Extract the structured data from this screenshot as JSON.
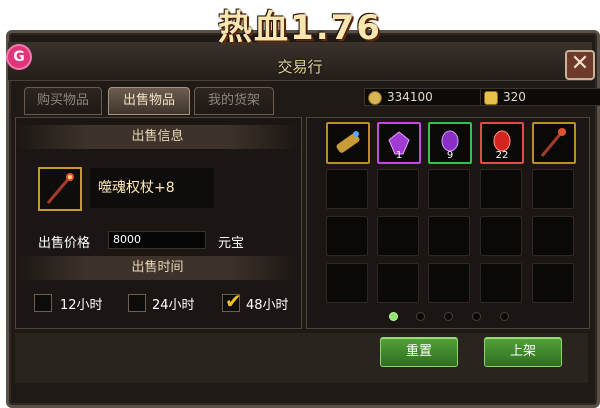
{
  "header": {
    "logo_text": "热血1.76",
    "window_title": "交易行",
    "app_icon_glyph": "G",
    "close_glyph": "✕"
  },
  "tabs": [
    {
      "label": "购买物品",
      "active": false
    },
    {
      "label": "出售物品",
      "active": true
    },
    {
      "label": "我的货架",
      "active": false
    }
  ],
  "currency": {
    "gold": "334100",
    "yuanbao": "320"
  },
  "sell_panel": {
    "info_header": "出售信息",
    "item_name": "噬魂权杖+8",
    "price_label": "出售价格",
    "price_value": "8000",
    "price_unit": "元宝",
    "time_header": "出售时间",
    "time_options": [
      {
        "label": "12小时",
        "checked": false
      },
      {
        "label": "24小时",
        "checked": false
      },
      {
        "label": "48小时",
        "checked": true
      }
    ]
  },
  "inventory": {
    "slots": [
      {
        "item": "golden-scroll-icon",
        "frame": "gold",
        "count": ""
      },
      {
        "item": "purple-gem-icon",
        "frame": "purple",
        "count": "1"
      },
      {
        "item": "violet-gem-icon",
        "frame": "green",
        "count": "9"
      },
      {
        "item": "red-gem-icon",
        "frame": "red",
        "count": "22"
      },
      {
        "item": "scepter-icon",
        "frame": "gold",
        "count": ""
      }
    ],
    "page_count": 5,
    "current_page": 1
  },
  "buttons": {
    "reset": "重置",
    "list": "上架"
  },
  "colors": {
    "accent_gold": "#c49a2f",
    "button_green": "#3f8a2b",
    "panel_bg": "#1b1613"
  }
}
